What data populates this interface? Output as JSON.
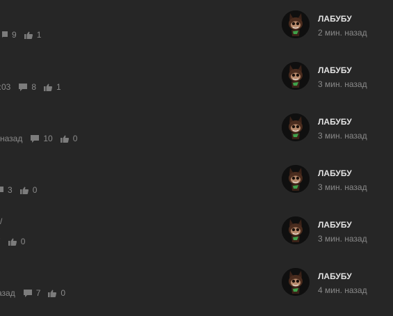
{
  "colors": {
    "background": "#262626",
    "muted_text": "#8a8a8a",
    "author_text": "#e2e2e2",
    "avatar_accent": "#3fa14a"
  },
  "icons": {
    "comments": "comment-bubble-icon",
    "likes": "thumbs-up-icon"
  },
  "items": [
    {
      "left_text": "",
      "meta_text": "",
      "comments": "9",
      "likes": "1",
      "author": "ЛАБУБУ",
      "time": "2 мин. назад"
    },
    {
      "left_text": "",
      "meta_text": "5:03",
      "comments": "8",
      "likes": "1",
      "author": "ЛАБУБУ",
      "time": "3 мин. назад"
    },
    {
      "left_text": "",
      "meta_text": "назад",
      "comments": "10",
      "likes": "0",
      "author": "ЛАБУБУ",
      "time": "3 мин. назад"
    },
    {
      "left_text": "",
      "meta_text": "",
      "comments": "3",
      "likes": "0",
      "author": "ЛАБУБУ",
      "time": "3 мин. назад"
    },
    {
      "left_text": "/",
      "meta_text": "",
      "comments": "7",
      "likes": "0",
      "author": "ЛАБУБУ",
      "time": "3 мин. назад"
    },
    {
      "left_text": "",
      "meta_text": "азад",
      "comments": "7",
      "likes": "0",
      "author": "ЛАБУБУ",
      "time": "4 мин. назад"
    }
  ]
}
